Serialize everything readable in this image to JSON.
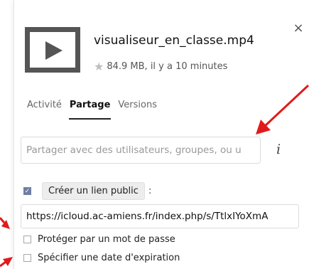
{
  "file": {
    "name": "visualiseur_en_classe.mp4",
    "meta": "84.9 MB, il y a 10 minutes",
    "icon": "video-play-icon"
  },
  "tabs": [
    {
      "label": "Activité",
      "active": false
    },
    {
      "label": "Partage",
      "active": true
    },
    {
      "label": "Versions",
      "active": false
    }
  ],
  "share": {
    "placeholder": "Partager avec des utilisateurs, groupes, ou u",
    "info": "i"
  },
  "public_link": {
    "checked": true,
    "button_label": "Créer un lien public",
    "colon": ":",
    "url": "https://icloud.ac-amiens.fr/index.php/s/TtlxIYoXmA"
  },
  "options": [
    {
      "label": "Protéger par un mot de passe",
      "checked": false
    },
    {
      "label": "Spécifier une date d'expiration",
      "checked": false
    }
  ],
  "close": "×",
  "colors": {
    "arrow": "#e01b1b",
    "checkbox_checked": "#6e7fa2"
  }
}
